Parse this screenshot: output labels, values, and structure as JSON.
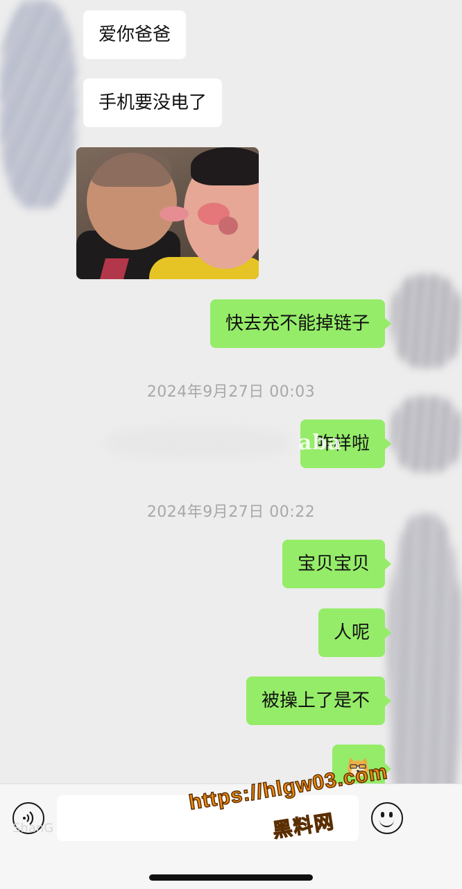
{
  "conversation": {
    "messages": [
      {
        "side": "in",
        "text": "爱你爸爸"
      },
      {
        "side": "in",
        "text": "手机要没电了"
      },
      {
        "side": "in",
        "type": "image"
      },
      {
        "side": "out",
        "text": "快去充不能掉链子"
      },
      {
        "side": "out",
        "text": "咋样啦"
      },
      {
        "side": "out",
        "text": "宝贝宝贝"
      },
      {
        "side": "out",
        "text": "人呢"
      },
      {
        "side": "out",
        "text": "被操上了是不"
      },
      {
        "side": "out",
        "type": "emoji",
        "icon": "doge-emoji"
      }
    ],
    "timestamps": [
      "2024年9月27日 00:03",
      "2024年9月27日 00:22"
    ]
  },
  "overlay": {
    "aba_text": "aba",
    "watermark_url": "https://hlgw03.com",
    "watermark_name": "黑料网",
    "faint_left_text": "ShanG"
  },
  "inputbar": {
    "voice_icon": "voice-icon",
    "emoji_icon": "emoji-face-icon",
    "input_value": ""
  },
  "colors": {
    "background": "#ededed",
    "outgoing_bubble": "#95ec69",
    "incoming_bubble": "#ffffff",
    "timestamp_text": "#a8a8a8",
    "watermark": "#f08a12"
  }
}
